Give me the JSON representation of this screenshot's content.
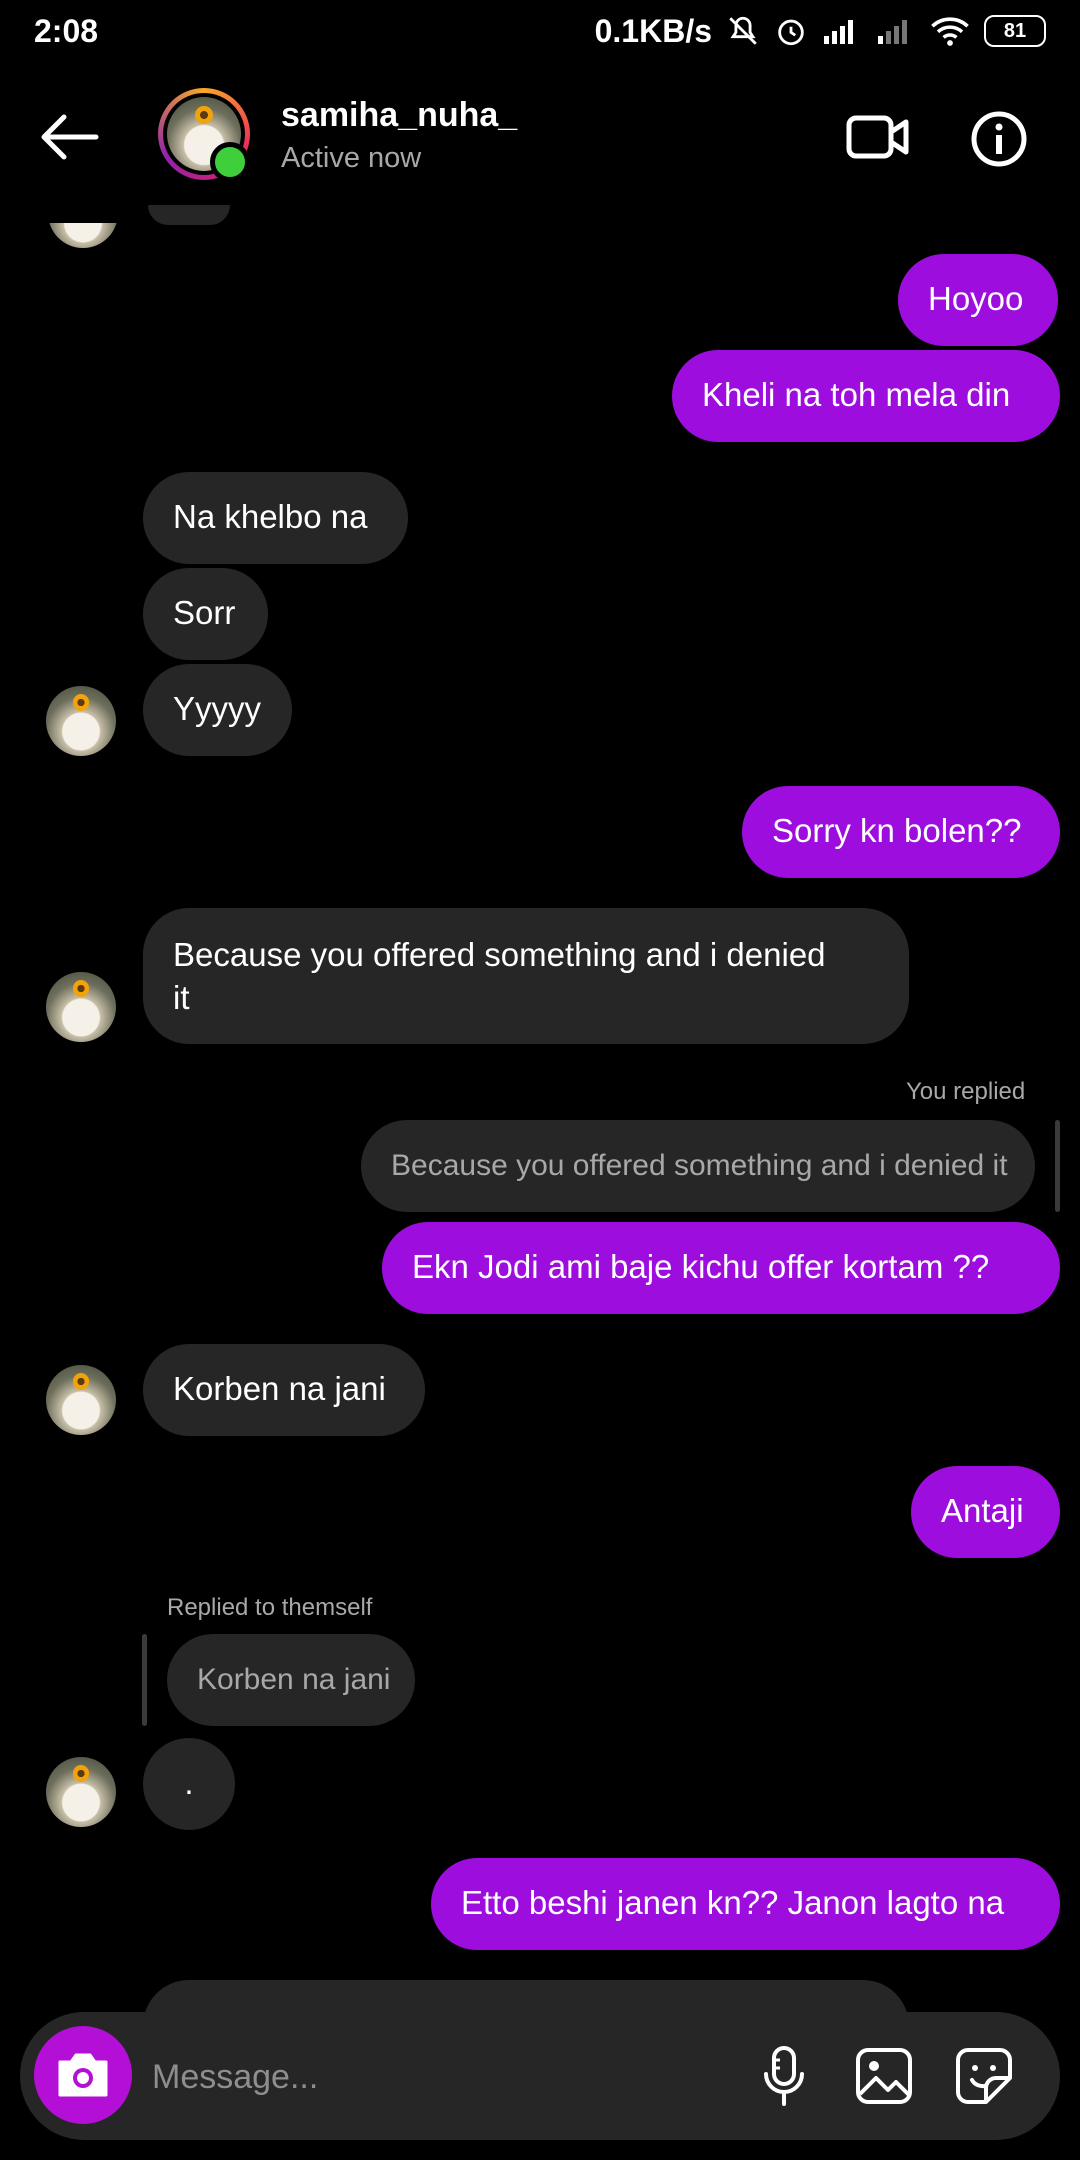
{
  "status_bar": {
    "time": "2:08",
    "net_speed": "0.1KB/s",
    "battery": "81"
  },
  "header": {
    "username": "samiha_nuha_",
    "status": "Active now"
  },
  "messages": [
    {
      "text": "Hoyoo"
    },
    {
      "text": "Kheli na toh mela din"
    },
    {
      "text": "Na khelbo na"
    },
    {
      "text": "Sorr"
    },
    {
      "text": "Yyyyy"
    },
    {
      "text": "Sorry kn bolen??"
    },
    {
      "text_line1": "Because you offered something and i denied",
      "text_line2": "it"
    },
    {
      "reply_label": "You replied",
      "quoted": "Because you offered something and i denied it"
    },
    {
      "text": "Ekn Jodi ami baje kichu offer kortam ??"
    },
    {
      "text": "Korben na jani"
    },
    {
      "text": "Antaji"
    },
    {
      "reply_label": "Replied to themself",
      "quoted": "Korben na jani"
    },
    {
      "text": "."
    },
    {
      "text": "Etto beshi janen kn?? Janon lagto na"
    }
  ],
  "composer": {
    "placeholder": "Message..."
  }
}
